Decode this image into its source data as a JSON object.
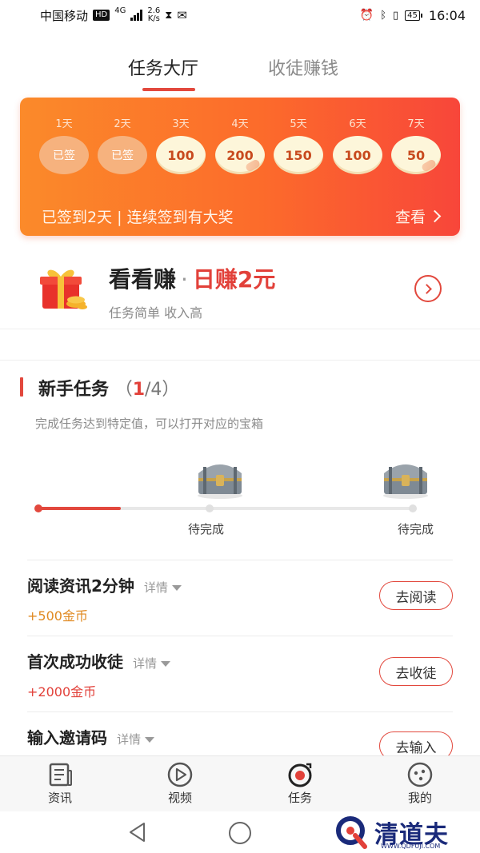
{
  "status_bar": {
    "carrier": "中国移动",
    "hd_badge": "HD",
    "network": "4G",
    "speed_value": "2.6",
    "speed_unit": "K/s",
    "battery": "45",
    "time": "16:04"
  },
  "tabs": [
    {
      "label": "任务大厅",
      "active": true
    },
    {
      "label": "收徒赚钱",
      "active": false
    }
  ],
  "checkin": {
    "days": [
      {
        "label": "1天",
        "value": "已签",
        "signed": true
      },
      {
        "label": "2天",
        "value": "已签",
        "signed": true
      },
      {
        "label": "3天",
        "value": "100",
        "signed": false
      },
      {
        "label": "4天",
        "value": "200",
        "signed": false
      },
      {
        "label": "5天",
        "value": "150",
        "signed": false
      },
      {
        "label": "6天",
        "value": "100",
        "signed": false
      },
      {
        "label": "7天",
        "value": "50",
        "signed": false
      }
    ],
    "summary": "已签到2天 | 连续签到有大奖",
    "more_label": "查看"
  },
  "watch_earn": {
    "title": "看看赚",
    "dot": "·",
    "highlight": "日赚2元",
    "subtitle": "任务简单 收入高"
  },
  "newbie": {
    "title": "新手任务",
    "progress_open": "（",
    "progress_done": "1",
    "progress_rest": "/4）",
    "description": "完成任务达到特定值，可以打开对应的宝箱",
    "progress_fraction": 0.22,
    "milestones": [
      {
        "label": "待完成"
      },
      {
        "label": "待完成"
      }
    ]
  },
  "tasks": [
    {
      "title": "阅读资讯2分钟",
      "detail": "详情",
      "reward": "+500金币",
      "button": "去阅读"
    },
    {
      "title": "首次成功收徒",
      "detail": "详情",
      "reward": "+2000金币",
      "button": "去收徒"
    },
    {
      "title": "输入邀请码",
      "detail": "详情",
      "reward": "",
      "button": "去输入"
    }
  ],
  "bottom_nav": [
    {
      "label": "资讯",
      "icon": "news-icon"
    },
    {
      "label": "视频",
      "icon": "video-play-icon"
    },
    {
      "label": "任务",
      "icon": "task-icon"
    },
    {
      "label": "我的",
      "icon": "profile-face-icon"
    }
  ],
  "watermark": {
    "text": "清道夫",
    "url_text": "WWW.QDFUJI.COM"
  },
  "colors": {
    "accent": "#e2483d",
    "card_start": "#fb8a2a",
    "card_end": "#f8463a",
    "reward_orange": "#e08a22"
  }
}
